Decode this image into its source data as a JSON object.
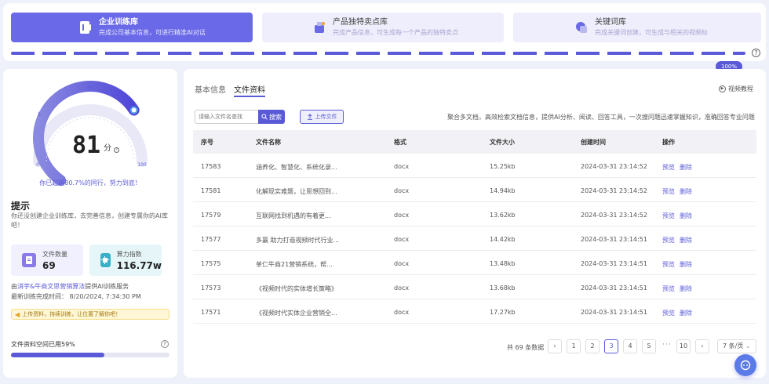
{
  "steps": [
    {
      "title": "企业训练库",
      "subtitle": "完成公司基本信息，可进行精准AI对话"
    },
    {
      "title": "产品独特卖点库",
      "subtitle": "完成产品信息，可生成每一个产品的独特卖点"
    },
    {
      "title": "关键词库",
      "subtitle": "完成关键词创建，可生成与相关的视频标"
    }
  ],
  "progress": {
    "label": "100%",
    "value": 100
  },
  "gauge": {
    "score": 81,
    "unit": "分",
    "max": 100,
    "ticks": [
      "0",
      "5",
      "50",
      "100"
    ],
    "exceed_text": "你已超越80.7%的同行，努力到底！"
  },
  "tips": {
    "title": "提示",
    "text": "你还没创建企业训练库，去完善信息，创建专属你的AI库吧！"
  },
  "stats": [
    {
      "label": "文件数量",
      "value": "69"
    },
    {
      "label": "算力指数",
      "value": "116.77w"
    }
  ],
  "source": {
    "prefix": "由",
    "brand": "消宇&牛商文思营销算法",
    "suffix": "提供AI训练服务"
  },
  "train_time": "最新训练完成时间： 8/20/2024, 7:34:30 PM",
  "notice": "上传资料，持续训练，让位置了解你吧！",
  "storage": {
    "label": "文件资料空间已用59%",
    "percent": 59
  },
  "tabs": [
    "基本信息",
    "文件资料"
  ],
  "video_help": "视频教程",
  "search": {
    "placeholder": "请输入文件名查找",
    "button": "搜索"
  },
  "upload_label": "上传文件",
  "description": "聚合多文档，高效检索文档信息，提供AI分析、阅读、回答工具，一次搜问题迅速掌握知识，准确回答专业问题",
  "table": {
    "headers": [
      "序号",
      "文件名称",
      "格式",
      "文件大小",
      "创建时间",
      "操作"
    ],
    "rows": [
      {
        "id": "17583",
        "name": "涵养化、智慧化、系统化录...",
        "format": "docx",
        "size": "15.25kb",
        "time": "2024-03-31 23:14:52"
      },
      {
        "id": "17581",
        "name": "化解现实难题，让思想回到...",
        "format": "docx",
        "size": "14.94kb",
        "time": "2024-03-31 23:14:52"
      },
      {
        "id": "17579",
        "name": "互联网找到机遇的有着更...",
        "format": "docx",
        "size": "13.62kb",
        "time": "2024-03-31 23:14:52"
      },
      {
        "id": "17577",
        "name": "多赢 助力打造视频时代行业...",
        "format": "docx",
        "size": "14.42kb",
        "time": "2024-03-31 23:14:51"
      },
      {
        "id": "17575",
        "name": "单仁牛商21营销系统，帮...",
        "format": "docx",
        "size": "13.48kb",
        "time": "2024-03-31 23:14:51"
      },
      {
        "id": "17573",
        "name": "《视频时代的实体增长策略》",
        "format": "docx",
        "size": "13.68kb",
        "time": "2024-03-31 23:14:51"
      },
      {
        "id": "17571",
        "name": "《视频时代实体企业营销全...",
        "format": "docx",
        "size": "17.27kb",
        "time": "2024-03-31 23:14:51"
      }
    ],
    "preview": "预览",
    "delete": "删除"
  },
  "pager": {
    "total": "共 69 条数据",
    "pages": [
      "1",
      "2",
      "3",
      "4",
      "5"
    ],
    "ellipsis": "···",
    "last": "10",
    "active": "3",
    "size": "7 条/页"
  },
  "colors": {
    "accent": "#5a5ad8",
    "gauge_start": "#8a8ae0",
    "gauge_end": "#4f46d8"
  }
}
